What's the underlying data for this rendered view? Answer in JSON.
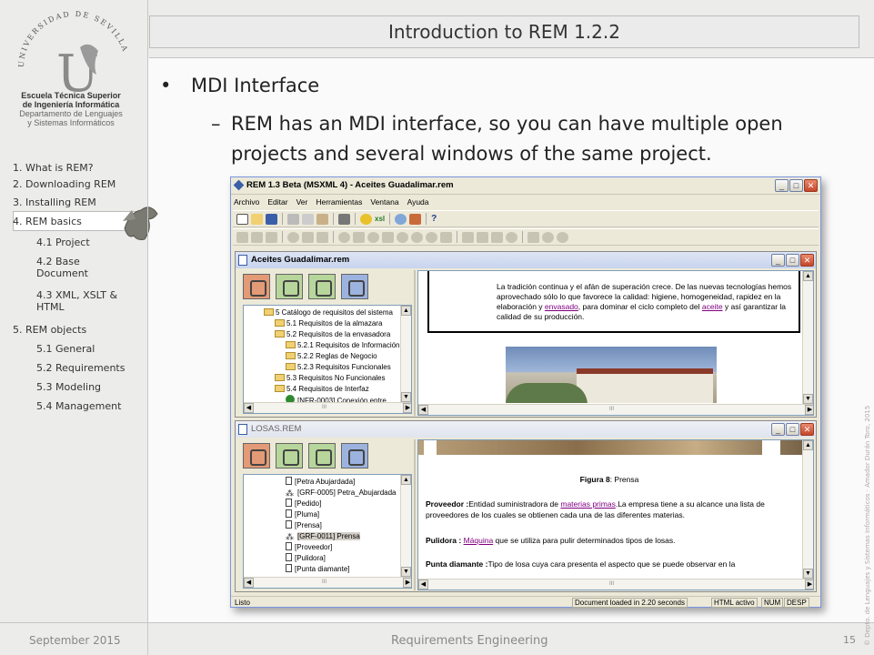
{
  "slide": {
    "title": "Introduction to REM 1.2.2",
    "bullet_symbol": "•",
    "dash_symbol": "–",
    "bullet": "MDI Interface",
    "subbullet": "REM has an MDI interface, so you can have multiple open projects and several windows of the same project."
  },
  "logo": {
    "arc_text": "UNIVERSIDAD DE SEVILLA",
    "monogram": "U",
    "caption_line1": "Escuela Técnica Superior",
    "caption_line2": "de Ingeniería Informática",
    "caption_line3": "Departamento de Lenguajes",
    "caption_line4": "y Sistemas Informáticos"
  },
  "nav": [
    {
      "label": "1.  What is REM?"
    },
    {
      "label": "2.  Downloading REM"
    },
    {
      "label": "3.  Installing REM"
    },
    {
      "label": "4.  REM basics"
    },
    {
      "label": "4.1 Project"
    },
    {
      "label": "4.2 Base Document"
    },
    {
      "label": "4.3 XML, XSLT & HTML"
    },
    {
      "label": "5. REM objects"
    },
    {
      "label": "5.1 General"
    },
    {
      "label": "5.2 Requirements"
    },
    {
      "label": "5.3 Modeling"
    },
    {
      "label": "5.4 Management"
    }
  ],
  "footer": {
    "left": "September 2015",
    "center": "Requirements Engineering",
    "right": "15",
    "copyright": "© Depto. de Lenguajes y Sistemas Informáticos · Amador Durán Toro, 2015"
  },
  "app": {
    "title": "REM 1.3 Beta (MSXML 4) - Aceites Guadalimar.rem",
    "menu": [
      "Archivo",
      "Editar",
      "Ver",
      "Herramientas",
      "Ventana",
      "Ayuda"
    ],
    "toolbar_xsl_label": "xsl",
    "toolbar_help_label": "?",
    "status": {
      "left": "Listo",
      "load": "Document loaded in 2.20 seconds",
      "html": "HTML activo",
      "num": "NUM",
      "desp": "DESP"
    },
    "win_buttons": {
      "minimize": "_",
      "maximize": "□",
      "close": "✕"
    },
    "scroll_arrows": {
      "up": "▲",
      "down": "▼",
      "left": "◀",
      "right": "▶"
    },
    "scroll_glyph": "III"
  },
  "window1": {
    "title": "Aceites Guadalimar.rem",
    "tree": [
      "5 Catálogo de requisitos del sistema",
      "5.1 Requisitos de la almazara",
      "5.2 Requisitos de la envasadora",
      "5.2.1 Requisitos de Información",
      "5.2.2 Reglas de Negocio",
      "5.2.3 Requisitos Funcionales",
      "5.3 Requisitos No Funcionales",
      "5.4 Requisitos de Interfaz",
      "[NFR-0003] Conexión entre"
    ],
    "para_a": "La tradición continua y el afán de superación crece. De las nuevas tecnologías hemos aprovechado sólo lo que favorece la calidad: higiene, homogeneidad, rapidez en la elaboración y ",
    "link1": "envasado",
    "para_b": ", para dominar el ciclo completo del ",
    "link2": "aceite",
    "para_c": " y así garantizar la calidad de su producción."
  },
  "window2": {
    "title": "LOSAS.REM",
    "tree": [
      "[Petra Abujardada]",
      "[GRF-0005] Petra_Abujardada",
      "[Pedido]",
      "[Pluma]",
      "[Prensa]",
      "[GRF-0011] Prensa",
      "[Proveedor]",
      "[Pulidora]",
      "[Punta diamante]"
    ],
    "figure_label": "Figura 8",
    "figure_caption": ": Prensa",
    "prov_term": "Proveedor :",
    "prov_a": "Entidad suministradora de ",
    "prov_link": "materias primas",
    "prov_b": ".La empresa tiene a su alcance una lista de proveedores de los cuales se obtienen cada una de las diferentes materias.",
    "pul_term": "Pulidora : ",
    "pul_link": "Máquina",
    "pul_b": " que se utiliza para pulir determinados tipos de losas.",
    "punta_term": "Punta diamante :",
    "punta_b": "Tipo de losa cuya cara presenta el aspecto que se puede observar en la"
  }
}
